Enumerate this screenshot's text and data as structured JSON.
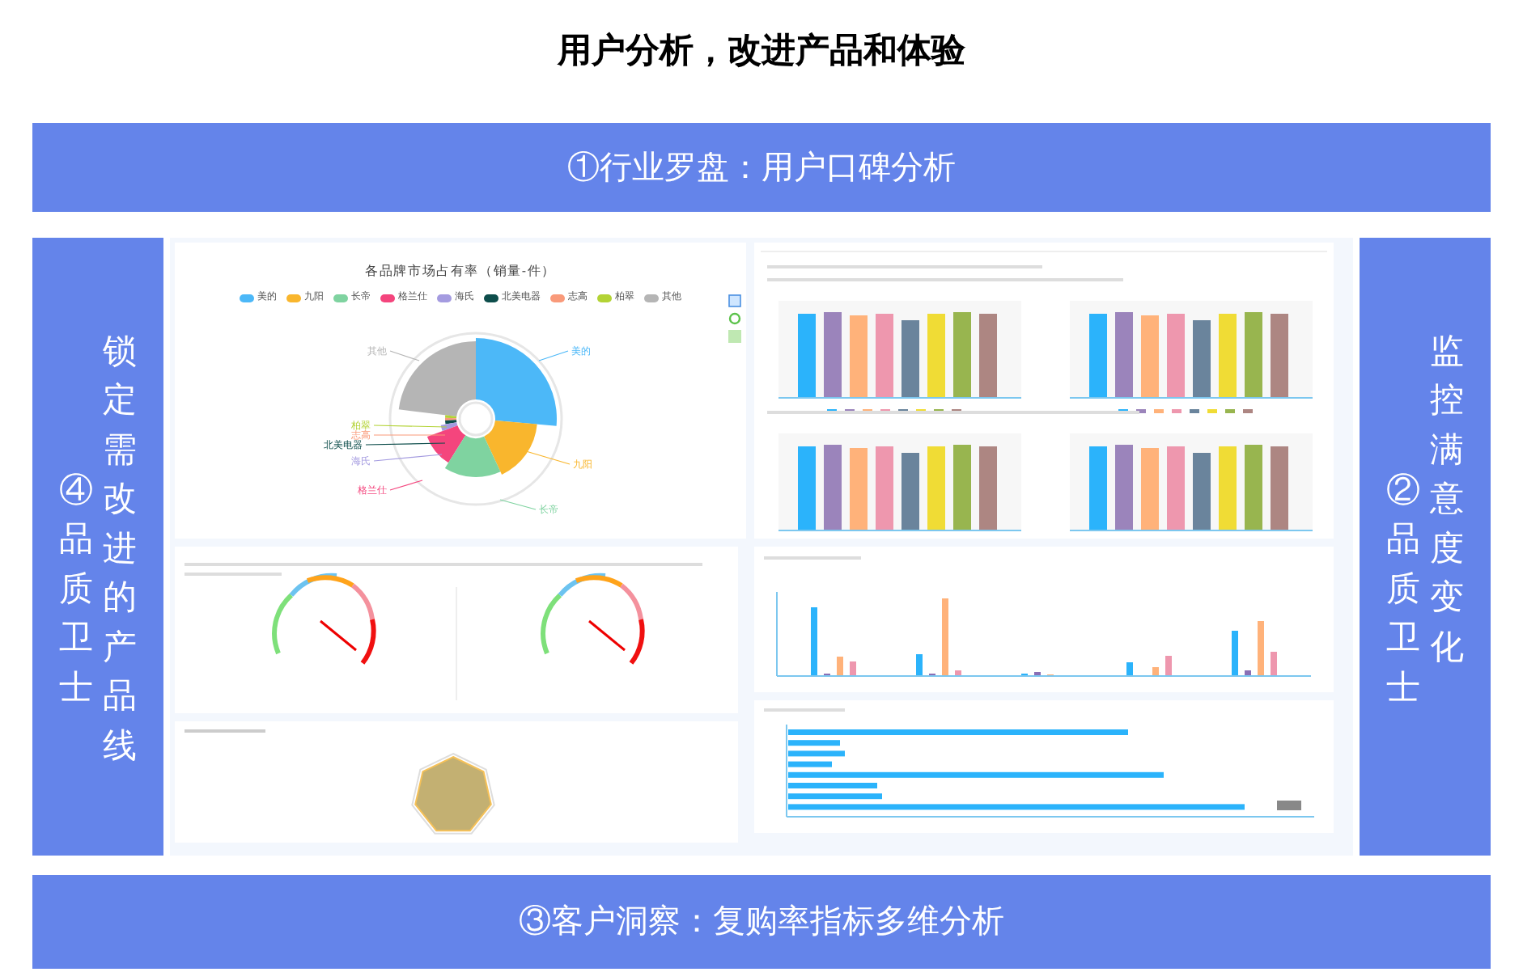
{
  "title": "用户分析，改进产品和体验",
  "top_banner": "①行业罗盘：用户口碑分析",
  "left_panel": {
    "label": "④品质卫士",
    "description": "锁定需改进的产品线"
  },
  "right_panel": {
    "label": "②品质卫士",
    "description": "监控满意度变化"
  },
  "pie_panel": {
    "title": "各品牌市场占有率（销量-件）",
    "brands": [
      {
        "name": "美的",
        "color": "#4cb8f8"
      },
      {
        "name": "九阳",
        "color": "#f9b62d"
      },
      {
        "name": "长帝",
        "color": "#7fd3a0"
      },
      {
        "name": "格兰仕",
        "color": "#f4457d"
      },
      {
        "name": "海氏",
        "color": "#a49be0"
      },
      {
        "name": "北美电器",
        "color": "#0d4d4b"
      },
      {
        "name": "志高",
        "color": "#f99a7a"
      },
      {
        "name": "柏翠",
        "color": "#b3d335"
      },
      {
        "name": "其他",
        "color": "#b5b5b5"
      }
    ],
    "slices": [
      {
        "label": "其他",
        "color": "#b5b5b5"
      },
      {
        "label": "美的",
        "color": "#4cb8f8"
      },
      {
        "label": "柏翠",
        "color": "#b3d335"
      },
      {
        "label": "志高",
        "color": "#f99a7a"
      },
      {
        "label": "北美电器",
        "color": "#0d4d4b"
      },
      {
        "label": "海氏",
        "color": "#a49be0"
      },
      {
        "label": "九阳",
        "color": "#f9b62d"
      },
      {
        "label": "格兰仕",
        "color": "#f4457d"
      },
      {
        "label": "长帝",
        "color": "#7fd3a0"
      }
    ]
  },
  "bottom_banner": "③客户洞察：复购率指标多维分析"
}
